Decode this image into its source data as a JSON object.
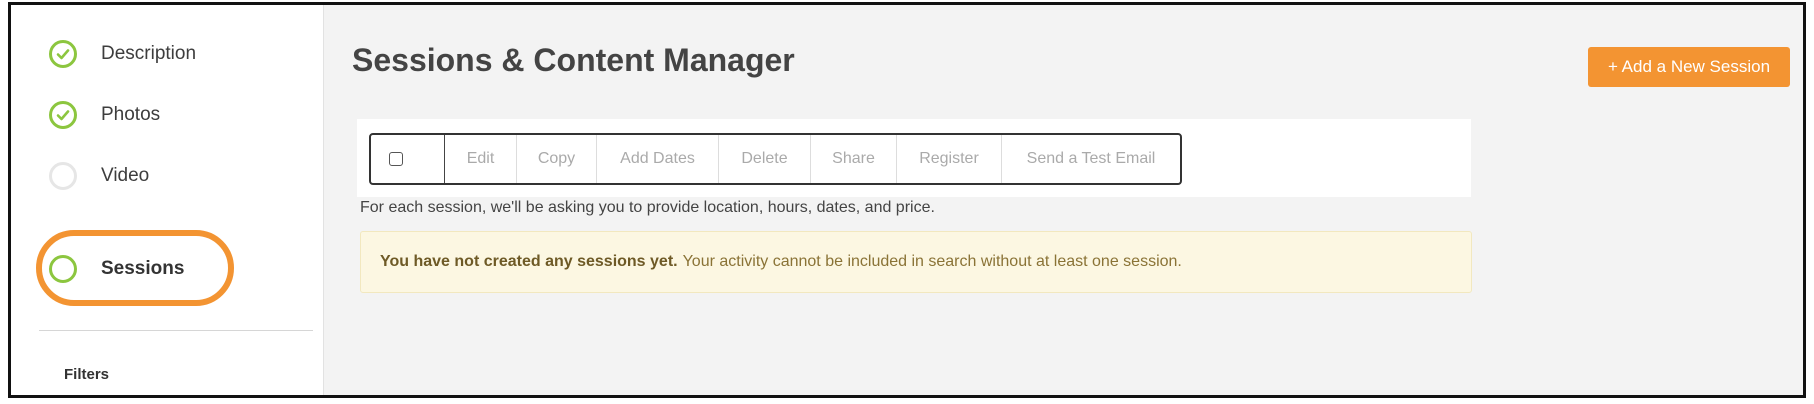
{
  "sidebar": {
    "items": [
      {
        "label": "Description",
        "status": "complete",
        "icon": "check-circle-icon"
      },
      {
        "label": "Photos",
        "status": "complete",
        "icon": "check-circle-icon"
      },
      {
        "label": "Video",
        "status": "incomplete",
        "icon": "empty-circle-icon"
      },
      {
        "label": "Sessions",
        "status": "current",
        "icon": "ring-circle-icon"
      }
    ],
    "filters_label": "Filters"
  },
  "main": {
    "title": "Sessions & Content Manager",
    "add_button": "+ Add a New Session",
    "toolbar": {
      "select_all_checked": false,
      "actions": [
        "Edit",
        "Copy",
        "Add Dates",
        "Delete",
        "Share",
        "Register",
        "Send a Test Email"
      ]
    },
    "hint": "For each session, we'll be asking you to provide location, hours, dates, and price.",
    "alert": {
      "strong": "You have not created any sessions yet.",
      "message": "Your activity cannot be included in search without at least one session."
    }
  },
  "colors": {
    "accent_orange": "#f39432",
    "check_green": "#8cc63f",
    "alert_background": "#fcf7e2",
    "alert_text": "#8a7336",
    "main_background": "#f3f3f3"
  }
}
